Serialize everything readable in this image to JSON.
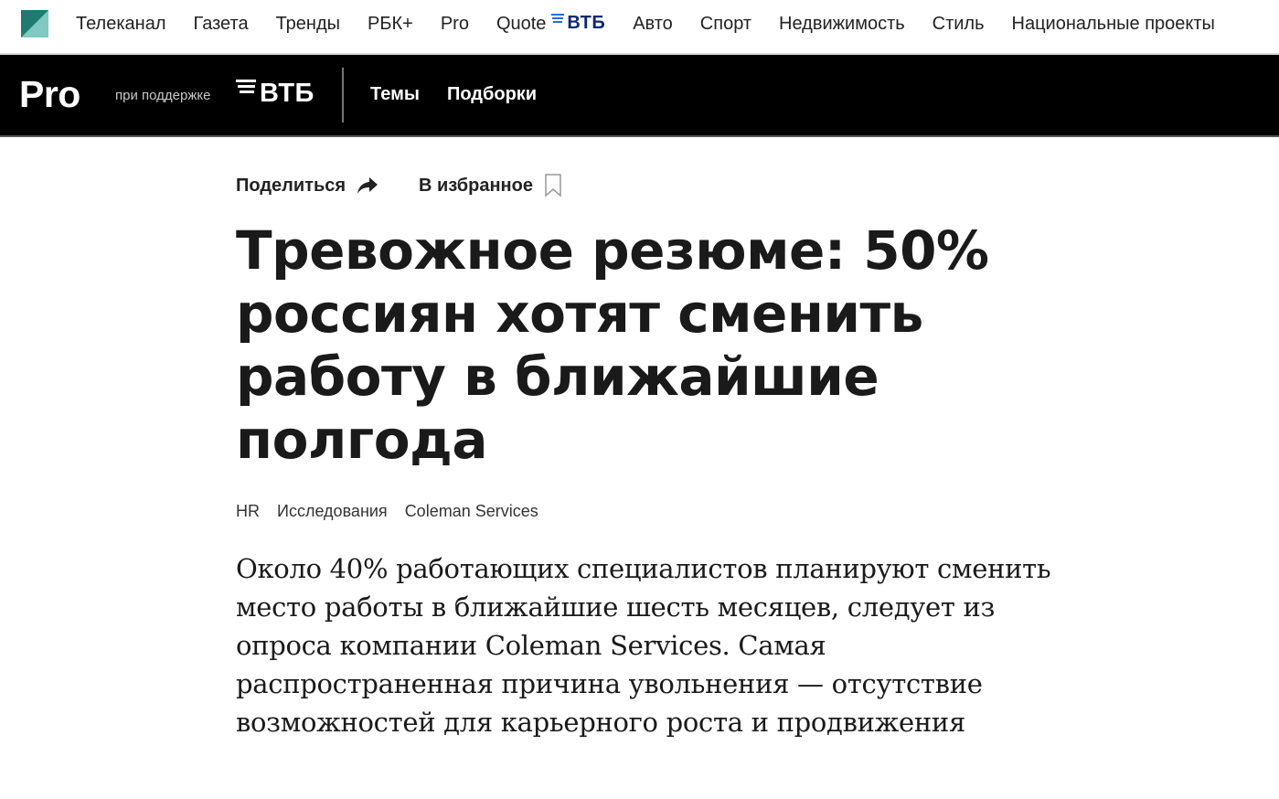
{
  "topnav": {
    "items": [
      {
        "label": "Телеканал"
      },
      {
        "label": "Газета"
      },
      {
        "label": "Тренды"
      },
      {
        "label": "РБК+"
      },
      {
        "label": "Pro"
      },
      {
        "label": "Quote",
        "badge": "ВТБ"
      },
      {
        "label": "Авто"
      },
      {
        "label": "Спорт"
      },
      {
        "label": "Недвижимость"
      },
      {
        "label": "Стиль"
      },
      {
        "label": "Национальные проекты"
      }
    ]
  },
  "probar": {
    "logo": "Pro",
    "support_text": "при поддержке",
    "sponsor": "ВТБ",
    "nav": [
      {
        "label": "Темы"
      },
      {
        "label": "Подборки"
      }
    ]
  },
  "article": {
    "share_label": "Поделиться",
    "favorite_label": "В избранное",
    "headline": "Тревожное резюме: 50% россиян хотят сменить работу в ближайшие полгода",
    "tags": [
      "HR",
      "Исследования",
      "Coleman Services"
    ],
    "lead": "Около 40% работающих специалистов планируют сменить место работы в ближайшие шесть месяцев, следует из опроса компании Coleman Services. Самая распространенная причина увольнения — отсутствие возможностей для карьерного роста и продвижения"
  },
  "colors": {
    "vtb_blue": "#0a2973",
    "vtb_light_blue": "#1f6fd6",
    "logo_teal": "#2a8f86",
    "header_black": "#000000"
  }
}
